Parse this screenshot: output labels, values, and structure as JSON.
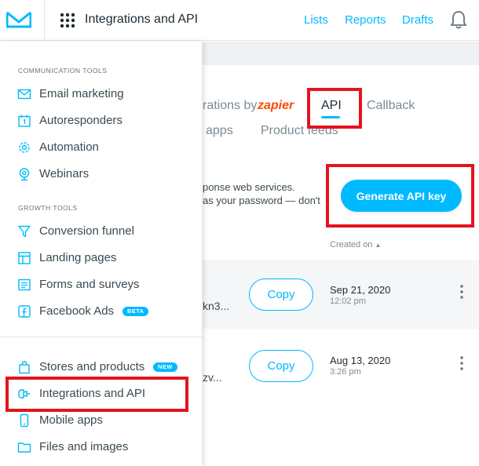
{
  "topbar": {
    "title": "Integrations and API",
    "nav": [
      "Lists",
      "Reports",
      "Drafts"
    ]
  },
  "tabs": {
    "integrations_partial": "rations by",
    "zapier": "zapier",
    "api": "API",
    "callback": "Callback",
    "apps_partial": "apps",
    "product_feeds": "Product feeds"
  },
  "description": {
    "line1": "ponse web services.",
    "line2": "as your password — don't"
  },
  "generate_button": "Generate API key",
  "table": {
    "created_on_header": "Created on",
    "rows": [
      {
        "key_fragment": "kn3...",
        "copy_label": "Copy",
        "date": "Sep 21, 2020",
        "time": "12:02 pm"
      },
      {
        "key_fragment": "zv...",
        "copy_label": "Copy",
        "date": "Aug 13, 2020",
        "time": "3:26 pm"
      }
    ]
  },
  "menu": {
    "communication_header": "COMMUNICATION TOOLS",
    "growth_header": "GROWTH TOOLS",
    "communication": [
      {
        "label": "Email marketing",
        "icon": "mail-icon"
      },
      {
        "label": "Autoresponders",
        "icon": "calendar-icon"
      },
      {
        "label": "Automation",
        "icon": "gear-icon"
      },
      {
        "label": "Webinars",
        "icon": "webcam-icon"
      }
    ],
    "growth": [
      {
        "label": "Conversion funnel",
        "icon": "funnel-icon"
      },
      {
        "label": "Landing pages",
        "icon": "layout-icon"
      },
      {
        "label": "Forms and surveys",
        "icon": "form-icon"
      },
      {
        "label": "Facebook Ads",
        "icon": "facebook-icon",
        "badge": "BETA"
      }
    ],
    "other": [
      {
        "label": "Stores and products",
        "icon": "bag-icon",
        "badge": "NEW"
      },
      {
        "label": "Integrations and API",
        "icon": "plug-icon"
      },
      {
        "label": "Mobile apps",
        "icon": "phone-icon"
      },
      {
        "label": "Files and images",
        "icon": "folder-icon"
      }
    ]
  },
  "colors": {
    "accent": "#00baff",
    "highlight": "#e3141f",
    "zapier": "#ff4a00"
  }
}
